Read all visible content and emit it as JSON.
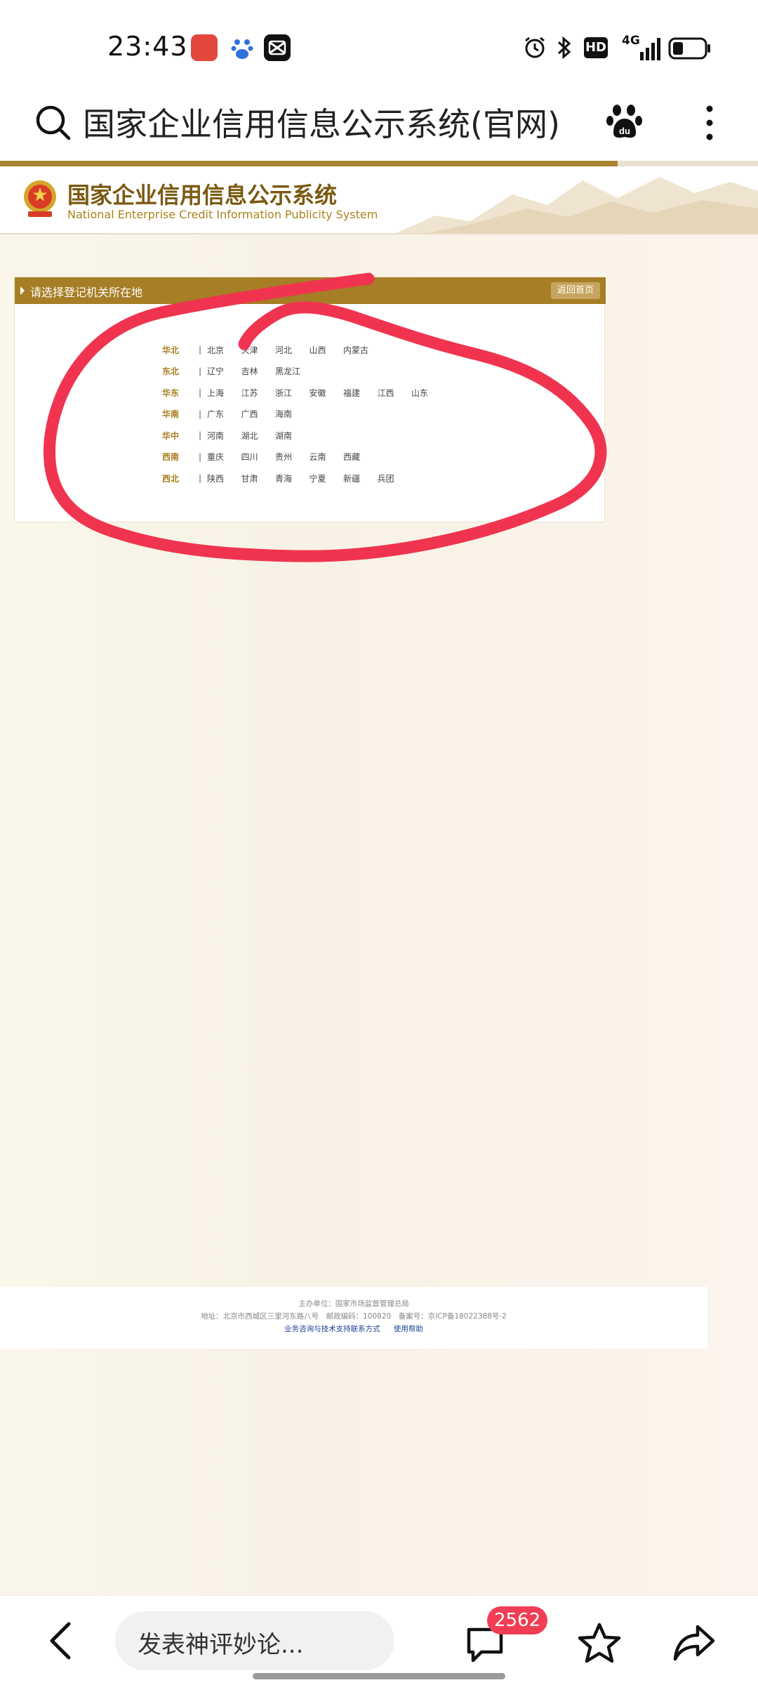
{
  "status_bar": {
    "time": "23:43",
    "network": "4G",
    "hd": "HD"
  },
  "browser": {
    "search_text": "国家企业信用信息公示系统(官网)",
    "progress": 0.815,
    "icons": [
      "search-icon",
      "baidu-paw-icon",
      "more-vertical-icon"
    ]
  },
  "site": {
    "title_cn": "国家企业信用信息公示系统",
    "title_en": "National Enterprise Credit Information Publicity System"
  },
  "panel": {
    "title": "请选择登记机关所在地",
    "home_button": "返回首页",
    "separator": "|",
    "regions": [
      {
        "name": "华北",
        "provinces": [
          "北京",
          "天津",
          "河北",
          "山西",
          "内蒙古"
        ]
      },
      {
        "name": "东北",
        "provinces": [
          "辽宁",
          "吉林",
          "黑龙江"
        ]
      },
      {
        "name": "华东",
        "provinces": [
          "上海",
          "江苏",
          "浙江",
          "安徽",
          "福建",
          "江西",
          "山东"
        ]
      },
      {
        "name": "华南",
        "provinces": [
          "广东",
          "广西",
          "海南"
        ]
      },
      {
        "name": "华中",
        "provinces": [
          "河南",
          "湖北",
          "湖南"
        ]
      },
      {
        "name": "西南",
        "provinces": [
          "重庆",
          "四川",
          "贵州",
          "云南",
          "西藏"
        ]
      },
      {
        "name": "西北",
        "provinces": [
          "陕西",
          "甘肃",
          "青海",
          "宁夏",
          "新疆",
          "兵团"
        ]
      }
    ]
  },
  "footer": {
    "sponsor": "主办单位：国家市场监督管理总局",
    "address": "地址：北京市西城区三里河东路八号　邮政编码：100820　备案号：京ICP备18022388号-2",
    "link_support": "业务咨询与技术支持联系方式",
    "link_help": "使用帮助"
  },
  "bottom_bar": {
    "comment_placeholder": "发表神评妙论...",
    "comment_count": "2562"
  },
  "colors": {
    "brand_gold": "#a67e26",
    "title_brown": "#7a5a12",
    "annotation_red": "#f0344f",
    "badge_red": "#f23d55"
  }
}
